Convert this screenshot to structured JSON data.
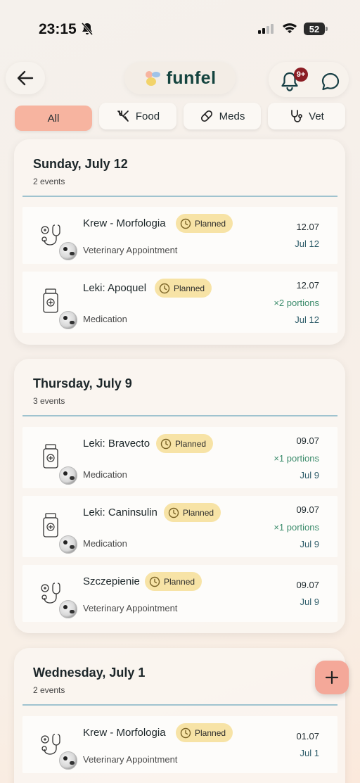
{
  "status_bar": {
    "time": "23:15",
    "battery_level": "52",
    "icons": [
      "bell-off-icon",
      "signal-icon",
      "wifi-icon",
      "battery-icon"
    ]
  },
  "header": {
    "logo_text": "funfel",
    "notification_badge": "9+",
    "icons": [
      "arrow-left-icon",
      "bell-icon",
      "chat-icon"
    ]
  },
  "filters": [
    {
      "label": "All",
      "icon": null,
      "active": true
    },
    {
      "label": "Food",
      "icon": "fork-knife-icon",
      "active": false
    },
    {
      "label": "Meds",
      "icon": "pill-icon",
      "active": false
    },
    {
      "label": "Vet",
      "icon": "stethoscope-icon",
      "active": false
    }
  ],
  "days": [
    {
      "title": "Sunday, July 12",
      "count": "2 events",
      "events": [
        {
          "title": "Krew - Morfologia",
          "status": "Planned",
          "type": "Veterinary Appointment",
          "date": "12.07",
          "portions": "",
          "short_date": "Jul 12",
          "icon": "stethoscope-icon"
        },
        {
          "title": "Leki: Apoquel",
          "status": "Planned",
          "type": "Medication",
          "date": "12.07",
          "portions": "×2 portions",
          "short_date": "Jul 12",
          "icon": "medicine-bottle-icon"
        }
      ]
    },
    {
      "title": "Thursday, July 9",
      "count": "3 events",
      "events": [
        {
          "title": "Leki: Bravecto",
          "status": "Planned",
          "type": "Medication",
          "date": "09.07",
          "portions": "×1 portions",
          "short_date": "Jul 9",
          "icon": "medicine-bottle-icon"
        },
        {
          "title": "Leki: Caninsulin",
          "status": "Planned",
          "type": "Medication",
          "date": "09.07",
          "portions": "×1 portions",
          "short_date": "Jul 9",
          "icon": "medicine-bottle-icon"
        },
        {
          "title": "Szczepienie",
          "status": "Planned",
          "type": "Veterinary Appointment",
          "date": "09.07",
          "portions": "",
          "short_date": "Jul 9",
          "icon": "stethoscope-icon"
        }
      ]
    },
    {
      "title": "Wednesday, July 1",
      "count": "2 events",
      "events": [
        {
          "title": "Krew - Morfologia",
          "status": "Planned",
          "type": "Veterinary Appointment",
          "date": "01.07",
          "portions": "",
          "short_date": "Jul 1",
          "icon": "stethoscope-icon"
        }
      ]
    }
  ],
  "fab": {
    "label": "+",
    "icon": "plus-icon"
  }
}
